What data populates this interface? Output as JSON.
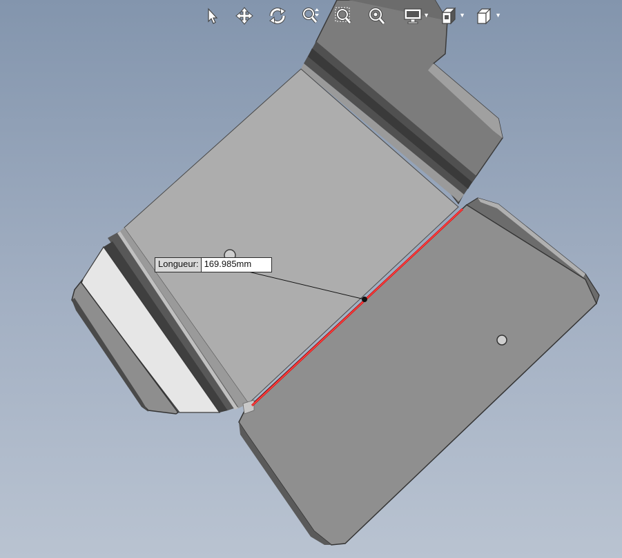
{
  "toolbar": {
    "items": [
      {
        "icon": "select-arrow-icon",
        "label": "Select"
      },
      {
        "icon": "pan-move-icon",
        "label": "Pan"
      },
      {
        "icon": "rotate-icon",
        "label": "Rotate"
      },
      {
        "icon": "zoom-in-out-icon",
        "label": "Zoom"
      },
      {
        "icon": "zoom-window-icon",
        "label": "Zoom window"
      },
      {
        "icon": "zoom-fit-icon",
        "label": "Zoom to fit"
      },
      {
        "icon": "display-monitor-icon",
        "label": "Display",
        "has_menu": true
      },
      {
        "icon": "view-orientation-icon",
        "label": "View",
        "has_menu": true
      },
      {
        "icon": "cube-view-icon",
        "label": "Standard views",
        "has_menu": true
      }
    ]
  },
  "measurement": {
    "label": "Longueur:",
    "value": "169.985mm"
  },
  "colors": {
    "background_top": "#8395ad",
    "background_bottom": "#b9c3d1",
    "selected_edge": "#e01010",
    "face_light": "#adadad",
    "face_dark": "#8e8e8e",
    "face_white": "#e6e6e6"
  }
}
